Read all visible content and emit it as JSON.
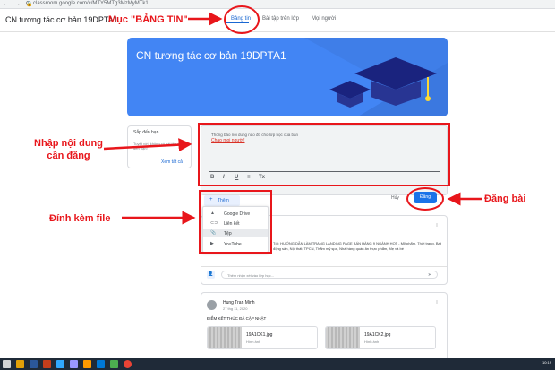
{
  "browser": {
    "nav_icons": "← → C",
    "url": "classroom.google.com/c/MTY5MTg3MzMyMTk1"
  },
  "header": {
    "title": "CN tương tác cơ bản 19DPTA1",
    "tabs": [
      {
        "label": "Bảng tin"
      },
      {
        "label": "Bài tập trên lớp"
      },
      {
        "label": "Mọi người"
      }
    ]
  },
  "banner": {
    "title": "CN tương tác cơ bản 19DPTA1",
    "color": "#4285f4"
  },
  "upcoming": {
    "title": "Sắp đến hạn",
    "text": "Tuyệt vời, không có bài tập nào sắp đến hạn!",
    "link": "Xem tất cả"
  },
  "editor": {
    "placeholder": "Thông báo nội dung nào đó cho lớp học của bạn",
    "content": "Chào mọi người!",
    "format_buttons": [
      "B",
      "I",
      "U",
      "≡",
      "Tx"
    ]
  },
  "actions": {
    "add_label": "Thêm",
    "cancel_label": "Hủy",
    "post_label": "Đăng"
  },
  "attach_menu": {
    "items": [
      {
        "icon": "google-drive-icon",
        "label": "Google Drive"
      },
      {
        "icon": "link-icon",
        "label": "Liên kết"
      },
      {
        "icon": "file-upload-icon",
        "label": "Tệp"
      },
      {
        "icon": "youtube-icon",
        "label": "YouTube"
      }
    ]
  },
  "announcement": {
    "text": "Tới: HƯỚNG DẪN LÀM TRANG LANDING PAGE BÁN HÀNG 9 NGÀNH HOT - Mỹ phẩm, Thời trang, Bất động sản, Nội thất, TPCN, Thẩm mỹ spa, Nhà hàng quán ăn thực phẩm, Mẹ và bé",
    "comment_placeholder": "Thêm nhận xét vào lớp học..."
  },
  "post2": {
    "author": "Hung Tran Minh",
    "date": "27 thg 11, 2020",
    "body": "ĐIỂM KẾT THÚC ĐÃ CẬP NHẬT",
    "attachments": [
      {
        "name": "19A1CK1.jpg",
        "type": "Hình ảnh"
      },
      {
        "name": "19A1CK2.jpg",
        "type": "Hình ảnh"
      }
    ]
  },
  "taskbar": {
    "time": "10:19"
  },
  "annotations": {
    "stream_tab": "Mục \"BẢNG TIN\"",
    "content_line1": "Nhập nội dung",
    "content_line2": "cần đăng",
    "attach_file": "Đính kèm file",
    "post": "Đăng bài",
    "color": "#e8161b"
  }
}
